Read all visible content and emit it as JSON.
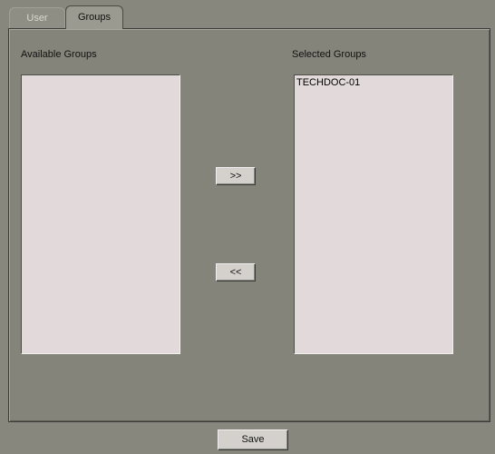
{
  "tabs": [
    {
      "label": "User",
      "active": false
    },
    {
      "label": "Groups",
      "active": true
    }
  ],
  "available": {
    "label": "Available Groups",
    "items": []
  },
  "selected": {
    "label": "Selected Groups",
    "items": [
      "TECHDOC-01"
    ]
  },
  "buttons": {
    "add": ">>",
    "remove": "<<",
    "save": "Save"
  },
  "colors": {
    "background": "#87877d",
    "listbox": "#e2dada",
    "button": "#d4d0cc"
  }
}
